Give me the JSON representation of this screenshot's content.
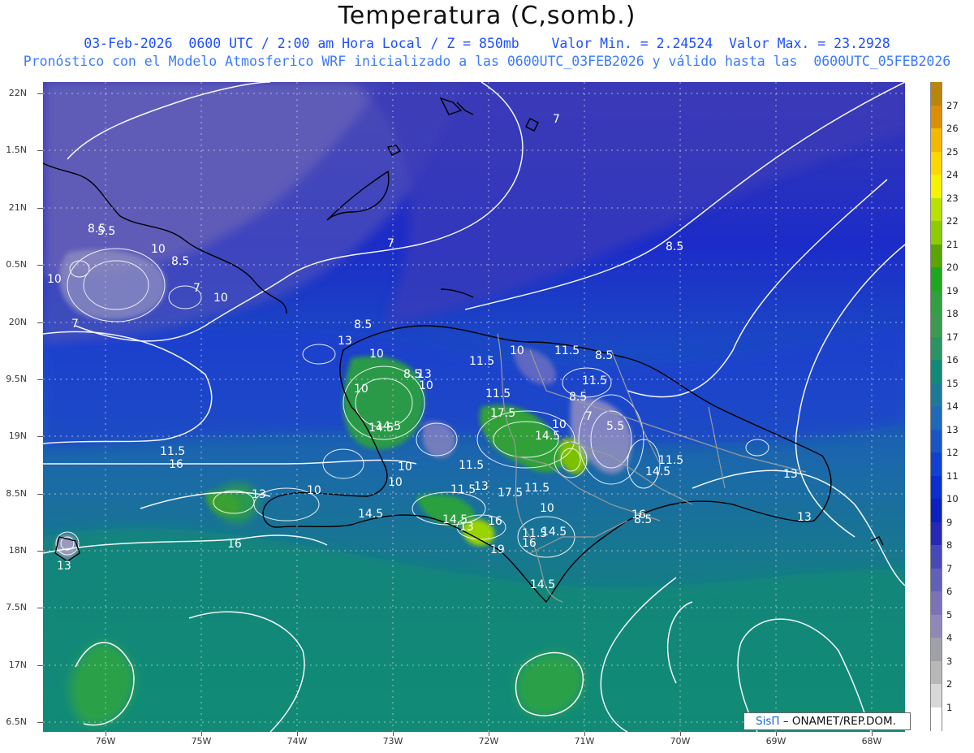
{
  "header": {
    "title": "Temperatura (C,somb.)",
    "subtitle_line1": "03-Feb-2026  0600 UTC / 2:00 am Hora Local / Z = 850mb    Valor Min. = 2.24524  Valor Max. = 23.2928",
    "subtitle_line2": "Pronóstico con el Modelo Atmosferico WRF inicializado a las 0600UTC_03FEB2026 y válido hasta las  0600UTC_05FEB2026"
  },
  "map": {
    "lat_labels": [
      "22N",
      "1.5N",
      "21N",
      "0.5N",
      "20N",
      "9.5N",
      "19N",
      "8.5N",
      "18N",
      "7.5N",
      "17N",
      "6.5N"
    ],
    "lon_labels": [
      "76W",
      "75W",
      "74W",
      "73W",
      "72W",
      "71W",
      "70W",
      "69W",
      "68W"
    ],
    "contour_labels": [
      "7",
      "8.5",
      "5.5",
      "7",
      "8.5",
      "10",
      "10",
      "8.5",
      "7",
      "10",
      "7",
      "8.5",
      "10",
      "13",
      "11.5",
      "8.5",
      "10",
      "8.5",
      "11.5",
      "10",
      "13",
      "11.5",
      "10",
      "8.5",
      "11.5",
      "14.5",
      "17.5",
      "10",
      "14.5",
      "7",
      "5.5",
      "14.5",
      "10",
      "10",
      "11.5",
      "16",
      "11.5",
      "11.5",
      "14.5",
      "13",
      "10",
      "11.5",
      "13",
      "17.5",
      "11.5",
      "14.5",
      "14.5",
      "13",
      "10",
      "16",
      "16",
      "11.5",
      "16",
      "13",
      "13",
      "8.5",
      "14.5",
      "19",
      "14.5",
      "13",
      "16"
    ]
  },
  "colorbar": {
    "labels": [
      "27",
      "26",
      "25",
      "24",
      "23",
      "22",
      "21",
      "20",
      "19",
      "18",
      "17",
      "16",
      "15",
      "14",
      "13",
      "12",
      "11",
      "10",
      "9",
      "8",
      "7",
      "6",
      "5",
      "4",
      "3",
      "2",
      "1"
    ],
    "colors": [
      "#b8860b",
      "#dc8e06",
      "#f5b800",
      "#ffd600",
      "#f7f200",
      "#b8e000",
      "#8ccc00",
      "#5aa500",
      "#1fa81f",
      "#30a040",
      "#3c9a50",
      "#2a9464",
      "#138a78",
      "#1c7a98",
      "#1e6ab8",
      "#1a55c8",
      "#1040d4",
      "#0a2ed0",
      "#0a20c0",
      "#2828b8",
      "#4848b8",
      "#6060b8",
      "#7c72b8",
      "#9088b8",
      "#a0a0a8",
      "#b8b8b8",
      "#d8d8d8",
      "#ffffff"
    ]
  },
  "credit": {
    "logo": "SisΠ",
    "text": "– ONAMET/REP.DOM."
  }
}
